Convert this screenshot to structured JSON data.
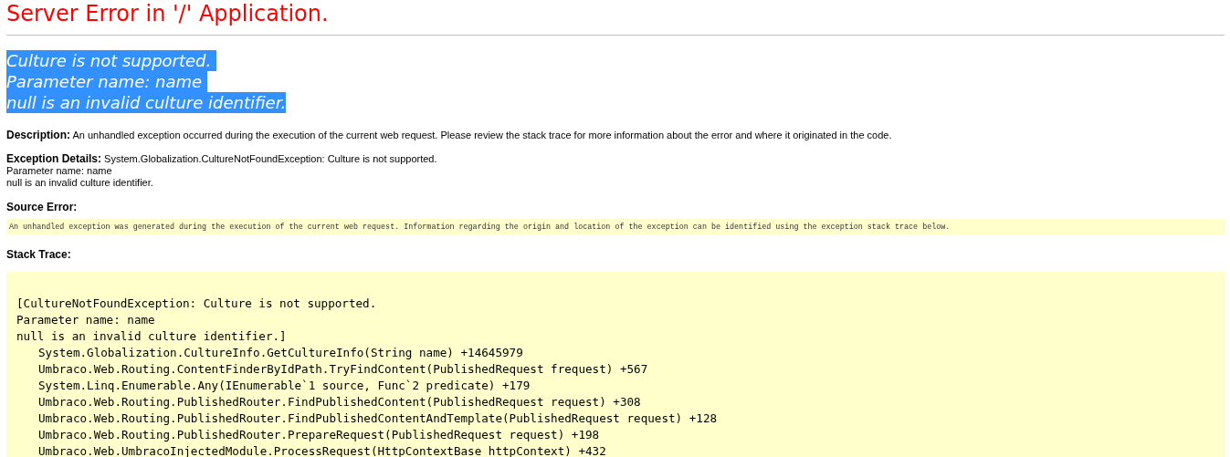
{
  "title": "Server Error in '/' Application.",
  "error_message": {
    "highlighted": true,
    "lines": [
      "Culture is not supported. ",
      "Parameter name: name ",
      "null is an invalid culture identifier."
    ]
  },
  "description": {
    "label": "Description:",
    "text": "An unhandled exception occurred during the execution of the current web request. Please review the stack trace for more information about the error and where it originated in the code."
  },
  "exception_details": {
    "label": "Exception Details:",
    "lines": [
      "System.Globalization.CultureNotFoundException: Culture is not supported.",
      "Parameter name: name",
      "null is an invalid culture identifier."
    ]
  },
  "source_error": {
    "label": "Source Error:",
    "text": "An unhandled exception was generated during the execution of the current web request. Information regarding the origin and location of the exception can be identified using the exception stack trace below."
  },
  "stack_trace": {
    "label": "Stack Trace:",
    "header_lines": [
      "[CultureNotFoundException: Culture is not supported.",
      "Parameter name: name",
      "null is an invalid culture identifier.]"
    ],
    "frames": [
      "System.Globalization.CultureInfo.GetCultureInfo(String name) +14645979",
      "Umbraco.Web.Routing.ContentFinderByIdPath.TryFindContent(PublishedRequest frequest) +567",
      "System.Linq.Enumerable.Any(IEnumerable`1 source, Func`2 predicate) +179",
      "Umbraco.Web.Routing.PublishedRouter.FindPublishedContent(PublishedRequest request) +308",
      "Umbraco.Web.Routing.PublishedRouter.FindPublishedContentAndTemplate(PublishedRequest request) +128",
      "Umbraco.Web.Routing.PublishedRouter.PrepareRequest(PublishedRequest request) +198",
      "Umbraco.Web.UmbracoInjectedModule.ProcessRequest(HttpContextBase httpContext) +432"
    ]
  }
}
